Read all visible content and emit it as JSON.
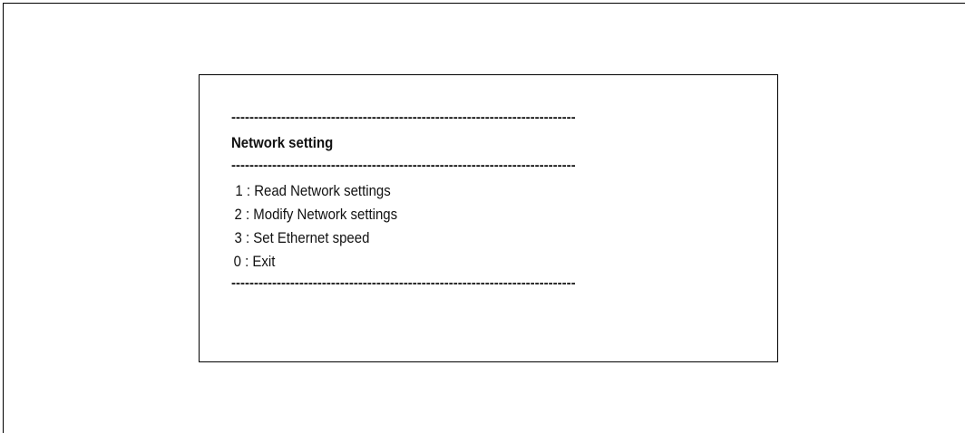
{
  "separator": "----------------------------------------------------------------------------",
  "menu": {
    "title": "Network setting",
    "items": [
      {
        "number": "1",
        "label": "1 : Read Network settings"
      },
      {
        "number": "2",
        "label": "2 : Modify Network settings"
      },
      {
        "number": "3",
        "label": "3 : Set Ethernet speed"
      },
      {
        "number": "0",
        "label": "0 : Exit"
      }
    ]
  }
}
